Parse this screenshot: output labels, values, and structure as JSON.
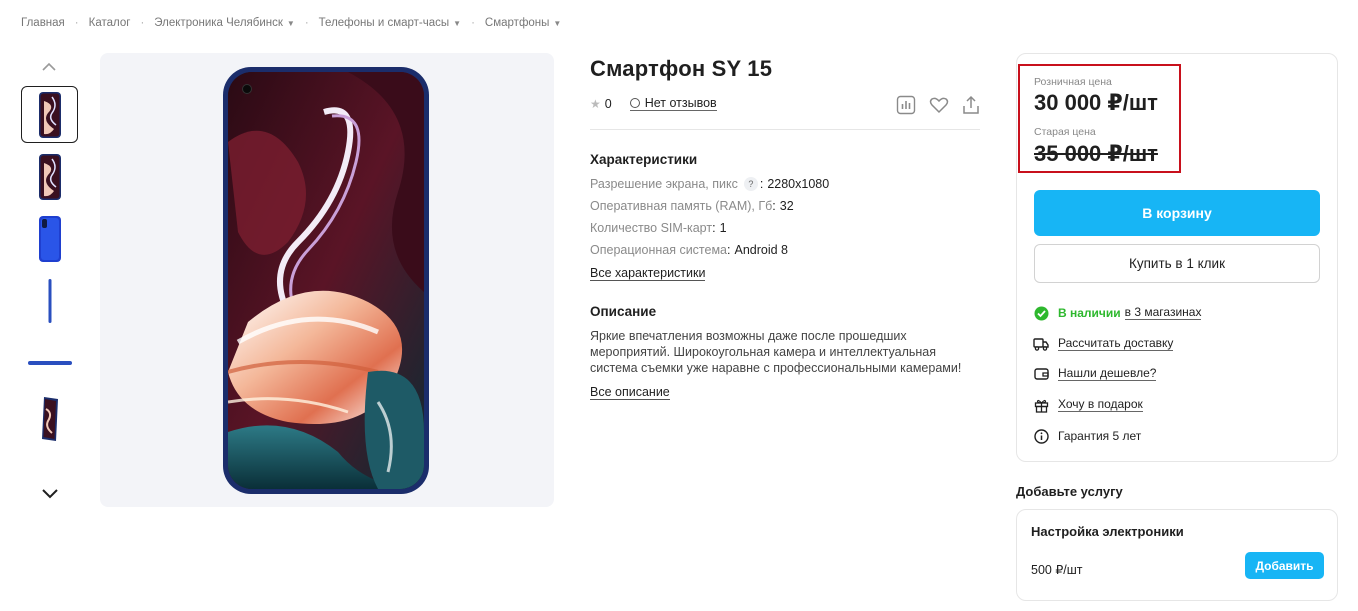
{
  "breadcrumb": [
    {
      "label": "Главная",
      "dropdown": false
    },
    {
      "label": "Каталог",
      "dropdown": false
    },
    {
      "label": "Электроника Челябинск",
      "dropdown": true
    },
    {
      "label": "Телефоны и смарт-часы",
      "dropdown": true
    },
    {
      "label": "Смартфоны",
      "dropdown": true
    }
  ],
  "gallery": {
    "thumbnails": 6,
    "active_index": 0,
    "icons": [
      "chevron-up-icon",
      "chevron-down-icon"
    ]
  },
  "product": {
    "title": "Смартфон SY 15",
    "rating": "0",
    "reviews_label": "Нет отзывов",
    "actions": [
      "compare-icon",
      "heart-icon",
      "share-icon"
    ]
  },
  "specs": {
    "heading": "Характеристики",
    "items": [
      {
        "label": "Разрешение экрана, пикс",
        "help": "?",
        "value": "2280x1080"
      },
      {
        "label": "Оперативная память (RAM), Гб",
        "value": "32"
      },
      {
        "label": "Количество SIM-карт",
        "value": "1"
      },
      {
        "label": "Операционная система",
        "value": "Android 8"
      }
    ],
    "all_link": "Все характеристики"
  },
  "description": {
    "heading": "Описание",
    "text": "Яркие впечатления возможны даже после прошедших мероприятий. Широкоугольная камера и интеллектуальная система съемки уже наравне с профессиональными камерами!",
    "all_link": "Все описание"
  },
  "price": {
    "retail_label": "Розничная цена",
    "retail_value": "30 000 ₽/шт",
    "old_label": "Старая цена",
    "old_value": "35 000 ₽/шт",
    "highlight_color": "#c8101c"
  },
  "buttons": {
    "cart": "В корзину",
    "one_click": "Купить в 1 клик",
    "accent": "#17b5f5"
  },
  "features": {
    "availability_status": "В наличии",
    "availability_stores": "в 3 магазинах",
    "delivery": "Рассчитать доставку",
    "cheaper": "Нашли дешевле?",
    "gift": "Хочу в подарок",
    "warranty": "Гарантия 5 лет"
  },
  "service": {
    "heading": "Добавьте услугу",
    "name": "Настройка электроники",
    "price": "500 ₽/шт",
    "add_button": "Добавить"
  }
}
